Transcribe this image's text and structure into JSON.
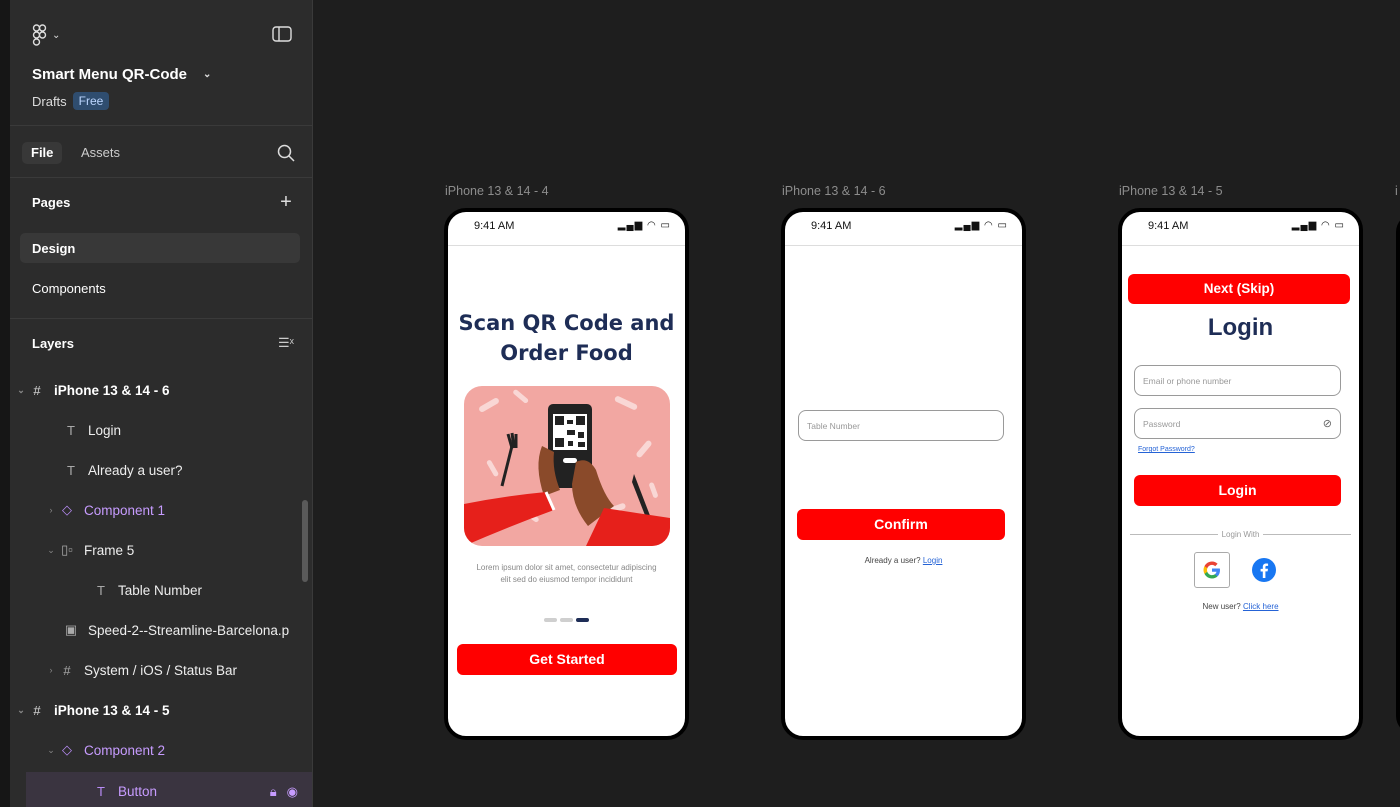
{
  "file": {
    "name": "Smart Menu QR-Code",
    "location": "Drafts",
    "plan": "Free"
  },
  "tabs": {
    "file": "File",
    "assets": "Assets"
  },
  "pages": {
    "header": "Pages",
    "items": [
      "Design",
      "Components"
    ]
  },
  "layers": {
    "header": "Layers",
    "items": [
      {
        "label": "iPhone 13 & 14 - 6",
        "kind": "frame"
      },
      {
        "label": "Login",
        "kind": "text"
      },
      {
        "label": "Already a user?",
        "kind": "text"
      },
      {
        "label": "Component 1",
        "kind": "component"
      },
      {
        "label": "Frame 5",
        "kind": "frame-child"
      },
      {
        "label": "Table Number",
        "kind": "text"
      },
      {
        "label": "Speed-2--Streamline-Barcelona.p",
        "kind": "image"
      },
      {
        "label": "System / iOS / Status Bar",
        "kind": "frame-child"
      },
      {
        "label": "iPhone 13 & 14 - 5",
        "kind": "frame"
      },
      {
        "label": "Component 2",
        "kind": "component"
      },
      {
        "label": "Button",
        "kind": "text"
      }
    ]
  },
  "canvas": {
    "frames": [
      {
        "label": "iPhone 13 & 14 - 4",
        "time": "9:41 AM",
        "title_line1": "Scan QR Code and",
        "title_line2": "Order Food",
        "lorem": "Lorem ipsum dolor sit amet, consectetur adipiscing elit sed do eiusmod tempor incididunt",
        "button": "Get Started"
      },
      {
        "label": "iPhone 13 & 14 - 6",
        "time": "9:41 AM",
        "input_placeholder": "Table Number",
        "button": "Confirm",
        "already": "Already a user?",
        "login_link": "Login"
      },
      {
        "label": "iPhone 13 & 14 - 5",
        "time": "9:41 AM",
        "skip_button": "Next (Skip)",
        "title": "Login",
        "email_placeholder": "Email or phone number",
        "password_placeholder": "Password",
        "forgot": "Forgot Password?",
        "button": "Login",
        "login_with": "Login With",
        "new_user": "New user?",
        "click_here": "Click here"
      }
    ],
    "partial_label": "i"
  },
  "colors": {
    "accent_red": "#ff0000",
    "navy": "#1e2d56",
    "component_purple": "#c79cff"
  }
}
